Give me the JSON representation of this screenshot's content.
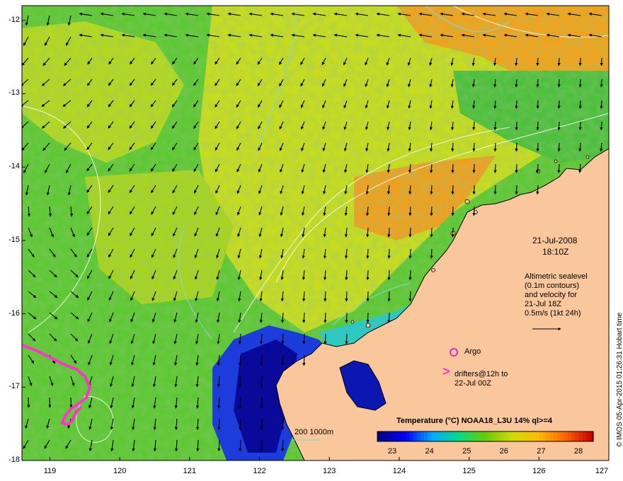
{
  "map": {
    "lat_ticks": [
      "-12",
      "-13",
      "-14",
      "-15",
      "-16",
      "-17",
      "-18"
    ],
    "lon_ticks": [
      "119",
      "120",
      "121",
      "122",
      "123",
      "124",
      "125",
      "126",
      "127"
    ],
    "lon_range": [
      118.6,
      127.0
    ],
    "lat_range": [
      -18.0,
      -11.8
    ],
    "colors": {
      "land": "#f9c79b",
      "drifter": "#ff33cc",
      "argo": "#cc33cc",
      "contour": "#7fd6e0"
    }
  },
  "info": {
    "date": "21-Jul-2008",
    "time": "18:10Z",
    "altimetry_lines": [
      "Altimetric sealevel",
      "(0.1m contours)",
      "and velocity for",
      "21-Jul 18Z",
      "0.5m/s (1kt 24h)"
    ],
    "argo_label": "Argo",
    "drifter_lines": [
      "drifters@12h to",
      "22-Jul 00Z"
    ],
    "drifter_marker": ">"
  },
  "bathy_label": "200 1000m",
  "colorbar": {
    "title": "Temperature (°C) NOAA18_L3U 14% ql>=4",
    "ticks": [
      "23",
      "24",
      "25",
      "26",
      "27",
      "28"
    ],
    "range": [
      22.6,
      28.4
    ],
    "colors": [
      "#00008b",
      "#0000ff",
      "#00aaff",
      "#00dd88",
      "#66cc00",
      "#ccdd00",
      "#ffbb00",
      "#ff6600",
      "#cc0000"
    ]
  },
  "credit": "© IMOS 05-Apr-2015 01:26:31 Hobart time"
}
